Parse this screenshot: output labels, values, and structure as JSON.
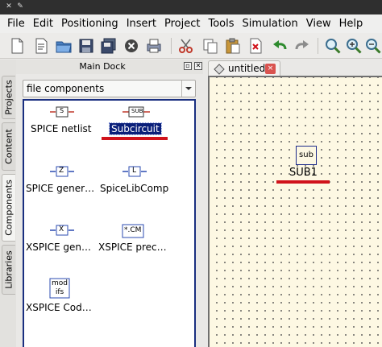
{
  "menu": [
    "File",
    "Edit",
    "Positioning",
    "Insert",
    "Project",
    "Tools",
    "Simulation",
    "View",
    "Help"
  ],
  "dock": {
    "title": "Main Dock",
    "tabs": [
      "Projects",
      "Content",
      "Components",
      "Libraries"
    ],
    "active_tab": "Components",
    "combo_value": "file components"
  },
  "components": [
    {
      "name": "SPICE netlist",
      "icon_text": "S"
    },
    {
      "name": "Subcircuit",
      "icon_text": "SUB",
      "selected": true
    },
    {
      "name": "SPICE gener…",
      "icon_text": "Z"
    },
    {
      "name": "SpiceLibComp",
      "icon_text": "L"
    },
    {
      "name": "XSPICE gen…",
      "icon_text": "X"
    },
    {
      "name": "XSPICE prec…",
      "icon_text": "*.CM"
    },
    {
      "name": "XSPICE Cod…",
      "icon_text": "mod ifs"
    }
  ],
  "document_tab": {
    "label": "untitled",
    "close_label": "×"
  },
  "canvas": {
    "component_text": "sub",
    "component_label": "SUB1"
  },
  "colors": {
    "canvas_bg": "#fdf8e3",
    "selection": "#0a1f7a",
    "highlight_red": "#d0121b",
    "list_border": "#1a2f80"
  }
}
